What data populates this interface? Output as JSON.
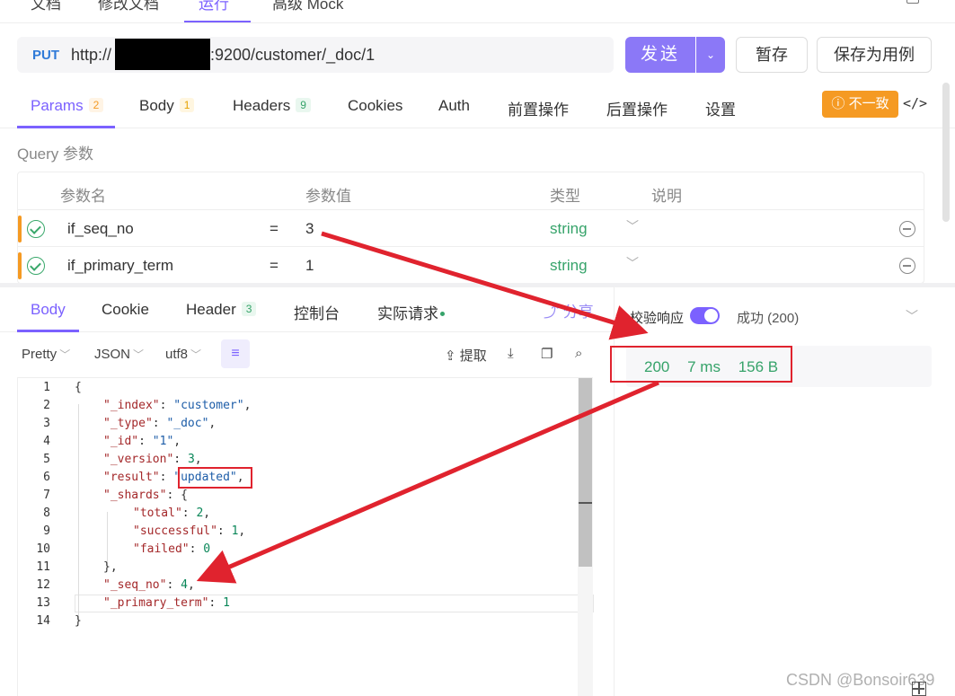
{
  "top_tabs": [
    "文档",
    "修改文档",
    "运行",
    "高级 Mock"
  ],
  "request": {
    "method": "PUT",
    "url_prefix": "http://",
    "url_suffix": ":9200/customer/_doc/1",
    "send_label": "发送",
    "save_label": "暂存",
    "save_case_label": "保存为用例"
  },
  "req_tabs": [
    {
      "label": "Params",
      "badge": "2"
    },
    {
      "label": "Body",
      "badge": "1"
    },
    {
      "label": "Headers",
      "badge": "9"
    },
    {
      "label": "Cookies"
    },
    {
      "label": "Auth"
    },
    {
      "label": "前置操作"
    },
    {
      "label": "后置操作"
    },
    {
      "label": "设置"
    }
  ],
  "warn_label": "不一致",
  "query": {
    "title": "Query 参数",
    "headers": {
      "name": "参数名",
      "value": "参数值",
      "type": "类型",
      "desc": "说明"
    },
    "rows": [
      {
        "name": "if_seq_no",
        "eq": "=",
        "value": "3",
        "type": "string"
      },
      {
        "name": "if_primary_term",
        "eq": "=",
        "value": "1",
        "type": "string"
      }
    ]
  },
  "resp_tabs": [
    {
      "label": "Body"
    },
    {
      "label": "Cookie"
    },
    {
      "label": "Header",
      "badge": "3"
    },
    {
      "label": "控制台"
    },
    {
      "label": "实际请求"
    }
  ],
  "share_label": "分享",
  "toolbar": {
    "pretty": "Pretty",
    "format": "JSON",
    "encoding": "utf8",
    "extract": "提取"
  },
  "code_lines": [
    "{",
    "\"_index\": \"customer\",",
    "\"_type\": \"_doc\",",
    "\"_id\": \"1\",",
    "\"_version\": 3,",
    "\"result\": \"updated\",",
    "\"_shards\": {",
    "\"total\": 2,",
    "\"successful\": 1,",
    "\"failed\": 0",
    "},",
    "\"_seq_no\": 4,",
    "\"_primary_term\": 1",
    "}"
  ],
  "validate": {
    "label": "校验响应",
    "result": "成功 (200)"
  },
  "status": {
    "code": "200",
    "time": "7 ms",
    "size": "156 B"
  },
  "watermark": "CSDN @Bonsoir639",
  "colors": {
    "accent": "#7b61ff",
    "success": "#36a36a",
    "warn": "#f59a23",
    "annotation": "#e0232e"
  }
}
